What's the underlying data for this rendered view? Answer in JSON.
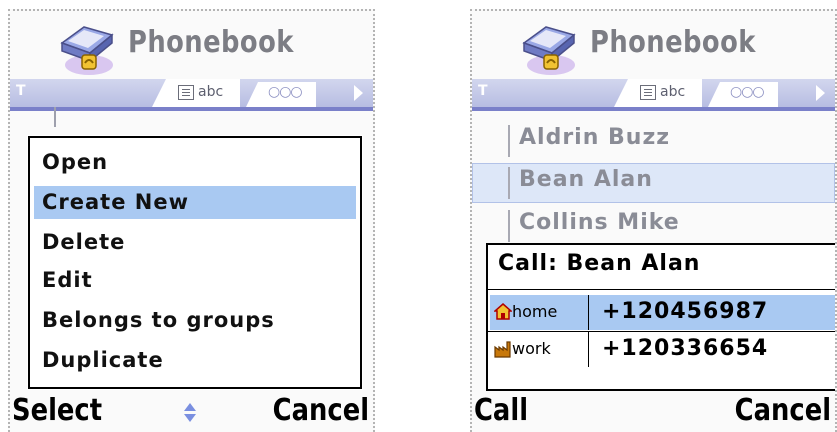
{
  "left_screen": {
    "title": "Phonebook",
    "tab_label": "abc",
    "menu_items": [
      "Open",
      "Create New",
      "Delete",
      "Edit",
      "Belongs to groups",
      "Duplicate"
    ],
    "selected_index": 1,
    "softkey_left": "Select",
    "softkey_right": "Cancel"
  },
  "right_screen": {
    "title": "Phonebook",
    "tab_label": "abc",
    "contacts": [
      "Aldrin Buzz",
      "Bean Alan",
      "Collins Mike"
    ],
    "selected_contact": 1,
    "call_title": "Call: Bean Alan",
    "numbers": [
      {
        "type": "home",
        "icon": "home-icon",
        "number": "+120456987"
      },
      {
        "type": "work",
        "icon": "factory-icon",
        "number": "+120336654"
      }
    ],
    "selected_number": 0,
    "softkey_left": "Call",
    "softkey_right": "Cancel"
  },
  "colors": {
    "highlight": "#a9c9f2",
    "tabbar": "#b7bde2",
    "title_gray": "#7c7d84"
  }
}
